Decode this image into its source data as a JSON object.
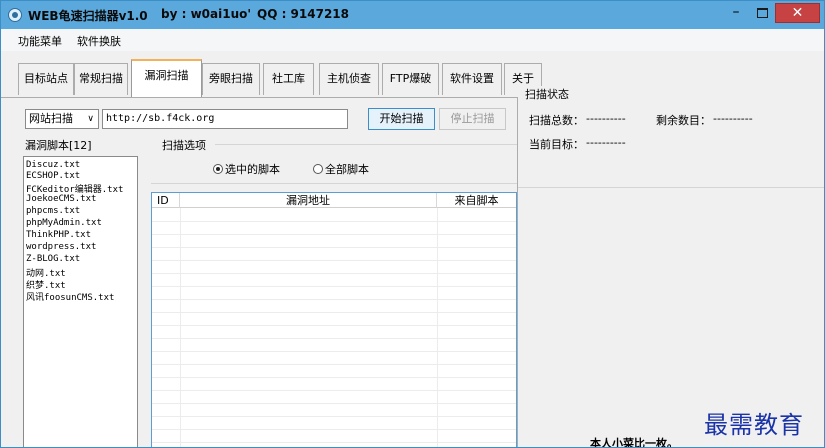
{
  "titlebar": {
    "app_name": "WEB龟速扫描器v1.0",
    "author": "by : w0ai1uo'",
    "qq": "QQ : 9147218",
    "minimize": "–",
    "close": "✕"
  },
  "menu": {
    "items": [
      "功能菜单",
      "软件换肤"
    ]
  },
  "tabs": [
    {
      "label": "目标站点"
    },
    {
      "label": "常规扫描"
    },
    {
      "label": "漏洞扫描"
    },
    {
      "label": "旁眼扫描"
    },
    {
      "label": "社工库"
    },
    {
      "label": "主机侦查"
    },
    {
      "label": "FTP爆破"
    },
    {
      "label": "软件设置"
    },
    {
      "label": "关于"
    }
  ],
  "scan": {
    "mode_selected": "网站扫描",
    "url": "http://sb.f4ck.org",
    "start_button": "开始扫描",
    "stop_button": "停止扫描"
  },
  "scripts": {
    "header": "漏洞脚本[12]",
    "items": [
      "Discuz.txt",
      "ECSHOP.txt",
      "FCKeditor编辑器.txt",
      "JoekoeCMS.txt",
      "phpcms.txt",
      "phpMyAdmin.txt",
      "ThinkPHP.txt",
      "wordpress.txt",
      "Z-BLOG.txt",
      "动网.txt",
      "织梦.txt",
      "风讯foosunCMS.txt"
    ]
  },
  "options": {
    "header": "扫描选项",
    "radio_selected": "选中的脚本",
    "radio_all": "全部脚本"
  },
  "results_table": {
    "columns": [
      "ID",
      "漏洞地址",
      "来自脚本"
    ],
    "rows": []
  },
  "status": {
    "header": "扫描状态",
    "total_label": "扫描总数：",
    "total_value": "----------",
    "remaining_label": "剩余数目：",
    "remaining_value": "----------",
    "current_label": "当前目标：",
    "current_value": "----------"
  },
  "footer": {
    "author_note": "本人小菜比一枚。",
    "watermark": "最需教育"
  }
}
